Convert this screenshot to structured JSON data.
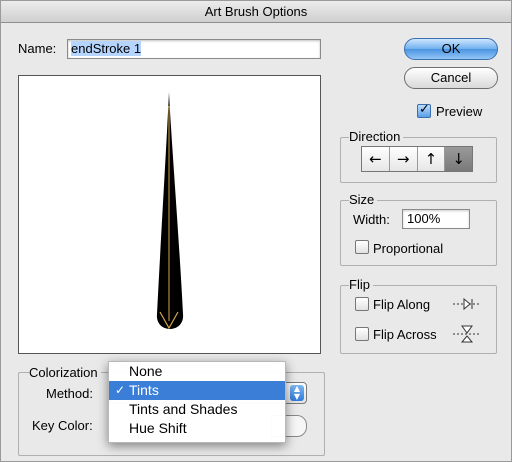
{
  "window": {
    "title": "Art Brush Options"
  },
  "name_field": {
    "label": "Name:",
    "value": "endStroke 1"
  },
  "buttons": {
    "ok": "OK",
    "cancel": "Cancel"
  },
  "preview_toggle": {
    "label": "Preview",
    "checked": true
  },
  "direction": {
    "title": "Direction",
    "arrows": [
      "←",
      "→",
      "↑",
      "↓"
    ],
    "selected": "↓"
  },
  "size": {
    "title": "Size",
    "width_label": "Width:",
    "width_value": "100%",
    "proportional_label": "Proportional",
    "proportional_checked": false
  },
  "flip": {
    "title": "Flip",
    "along_label": "Flip Along",
    "across_label": "Flip Across"
  },
  "colorization": {
    "title": "Colorization",
    "method_label": "Method:",
    "key_color_label": "Key Color:",
    "menu_items": [
      "None",
      "Tints",
      "Tints and Shades",
      "Hue Shift"
    ],
    "selected_index": 1,
    "selected_mark": "✓"
  },
  "icons": {
    "flip_along": "flip-along-icon",
    "flip_across": "flip-across-icon",
    "stepper": "popup-stepper-icon"
  },
  "colors": {
    "accent": "#3a7ed8",
    "stroke": "#000000",
    "stroke_highlight": "#d7a64a"
  }
}
